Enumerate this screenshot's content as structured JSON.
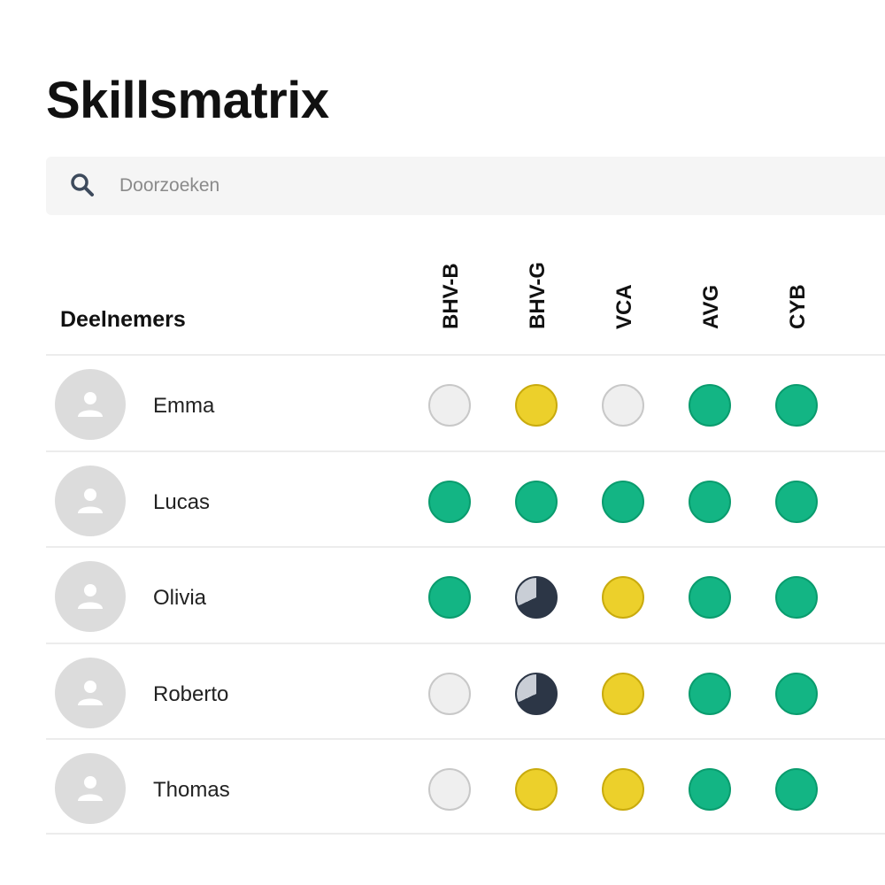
{
  "page": {
    "title": "Skillsmatrix"
  },
  "search": {
    "placeholder": "Doorzoeken",
    "icon": "search-icon"
  },
  "table": {
    "participants_header": "Deelnemers",
    "skills": [
      "BHV-B",
      "BHV-G",
      "VCA",
      "AVG",
      "CYB"
    ],
    "rows": [
      {
        "name": "Emma",
        "statuses": [
          "gray",
          "yellow",
          "gray",
          "green",
          "green"
        ]
      },
      {
        "name": "Lucas",
        "statuses": [
          "green",
          "green",
          "green",
          "green",
          "green"
        ]
      },
      {
        "name": "Olivia",
        "statuses": [
          "green",
          "pie",
          "yellow",
          "green",
          "green"
        ]
      },
      {
        "name": "Roberto",
        "statuses": [
          "gray",
          "pie",
          "yellow",
          "green",
          "green"
        ]
      },
      {
        "name": "Thomas",
        "statuses": [
          "gray",
          "yellow",
          "yellow",
          "green",
          "green"
        ]
      }
    ]
  },
  "status_colors": {
    "gray": "#efefef",
    "yellow": "#ecd02b",
    "green": "#13b584",
    "pie": "#2c3646"
  }
}
